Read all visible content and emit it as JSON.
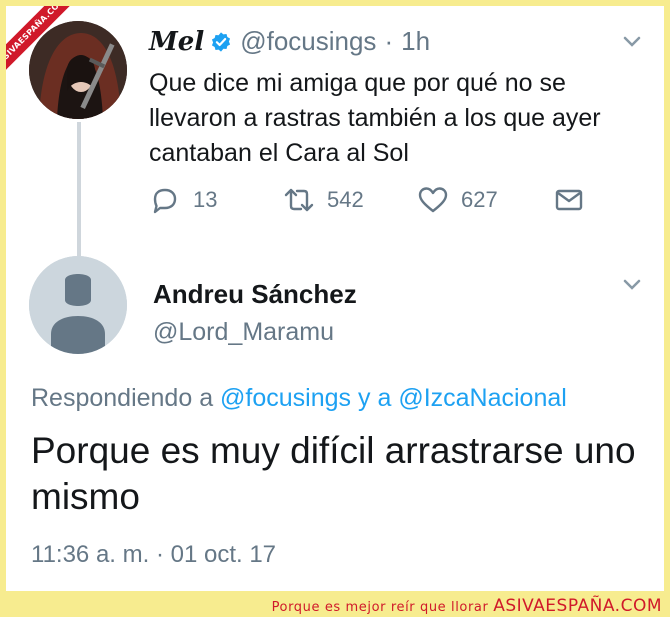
{
  "watermark": {
    "ribbon_text": "ASIVAESPAÑA.COM"
  },
  "tweet": {
    "author_name": "Mel",
    "handle": "@focusings",
    "separator": "·",
    "time": "1h",
    "text": "Que dice mi amiga que por qué no se llevaron a rastras también a los que ayer cantaban el Cara al Sol",
    "replies": "13",
    "retweets": "542",
    "likes": "627",
    "avatar_icon": "user-photo-avatar",
    "verified_icon": "verified-badge-icon"
  },
  "reply": {
    "author_name": "Andreu Sánchez",
    "handle": "@Lord_Maramu",
    "replying_prefix": "Respondiendo a",
    "replying_user1": "@focusings",
    "replying_joiner": "y a",
    "replying_user2": "@IzcaNacional",
    "text": "Porque es muy difícil arrastrarse uno mismo",
    "timestamp": "11:36 a. m. · 01 oct. 17",
    "avatar_icon": "default-avatar-icon"
  },
  "footer": {
    "caption": "Porque es mejor reír que llorar",
    "brand": "ASIVAESPAÑA.COM"
  },
  "colors": {
    "background": "#f7ec8f",
    "link": "#1da1f2",
    "muted": "#657786",
    "text": "#14171a",
    "brand_red": "#d0192a"
  }
}
